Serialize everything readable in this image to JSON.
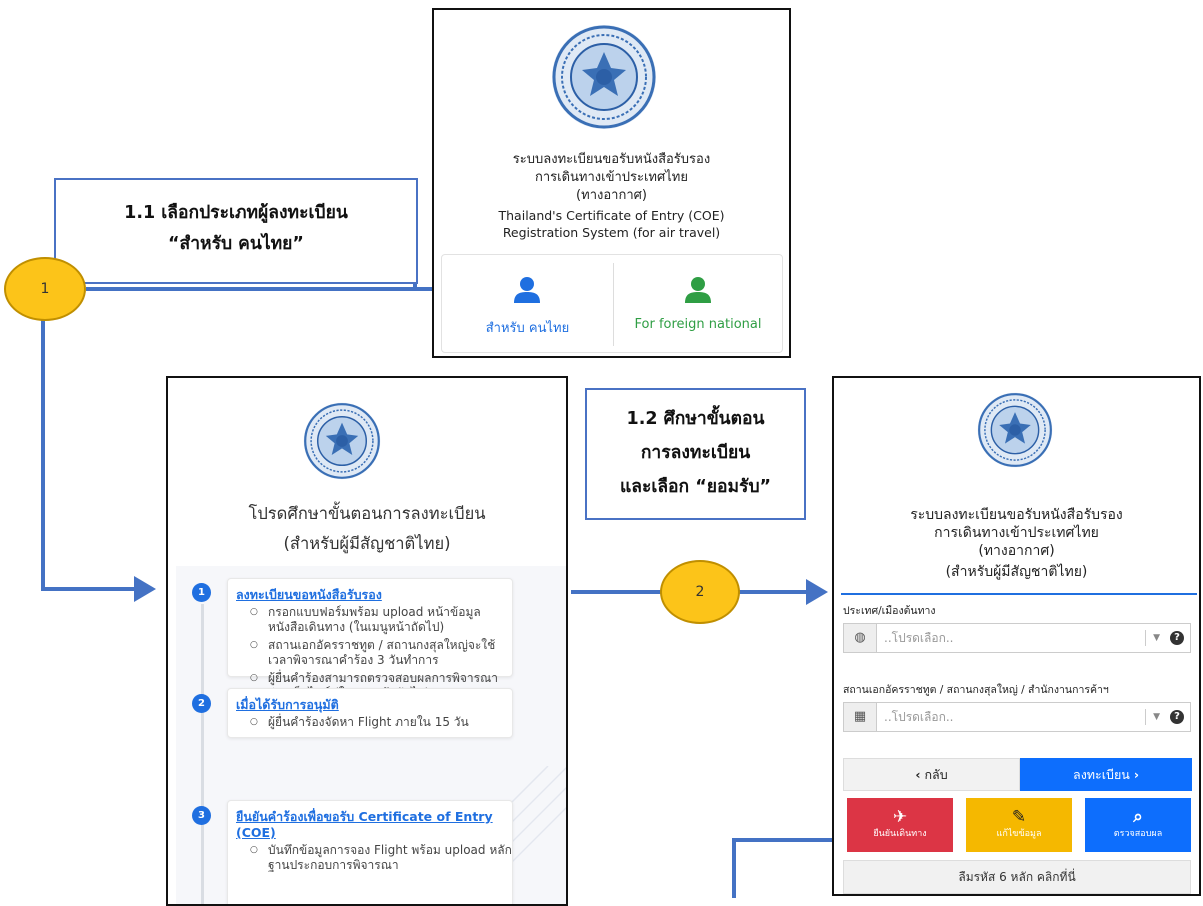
{
  "panel1": {
    "title_lines": [
      "ระบบลงทะเบียนขอรับหนังสือรับรอง",
      "การเดินทางเข้าประเทศไทย",
      "(ทางอากาศ)"
    ],
    "subtitle_lines": [
      "Thailand's Certificate of Entry (COE)",
      "Registration System (for air travel)"
    ],
    "choice_thai": "สำหรับ คนไทย",
    "choice_foreign": "For foreign national",
    "colors": {
      "thai": "#1f6fe0",
      "foreign": "#2f9e44"
    }
  },
  "annotation1": {
    "lines": [
      "1.1 เลือกประเภทผู้ลงทะเบียน",
      "“สำหรับ คนไทย”"
    ],
    "number": "1"
  },
  "annotation2": {
    "lines": [
      "1.2 ศึกษาขั้นตอน",
      "การลงทะเบียน",
      "และเลือก “ยอมรับ”"
    ],
    "number": "2"
  },
  "panel2": {
    "title_lines": [
      "โปรดศึกษาขั้นตอนการลงทะเบียน",
      "(สำหรับผู้มีสัญชาติไทย)"
    ],
    "steps": [
      {
        "number": "1",
        "title": "ลงทะเบียนขอหนังสือรับรอง",
        "items": [
          "กรอกแบบฟอร์มพร้อม upload หน้าข้อมูลหนังสือเดินทาง (ในเมนูหน้าถัดไป)",
          "สถานเอกอัครราชทูต / สถานกงสุลใหญ่จะใช้เวลาพิจารณาคำร้อง 3 วันทำการ",
          "ผู้ยื่นคำร้องสามารถตรวจสอบผลการพิจารณาผ่านเว็บไซต์ (ในเมนูหน้าถัดไป)"
        ]
      },
      {
        "number": "2",
        "title": "เมื่อได้รับการอนุมัติ",
        "items": [
          "ผู้ยื่นคำร้องจัดหา Flight ภายใน 15 วัน"
        ]
      },
      {
        "number": "3",
        "title": "ยืนยันคำร้องเพื่อขอรับ Certificate of Entry (COE)",
        "items": [
          "บันทึกข้อมูลการจอง Flight พร้อม upload หลักฐานประกอบการพิจารณา"
        ]
      }
    ]
  },
  "panel3": {
    "title_lines": [
      "ระบบลงทะเบียนขอรับหนังสือรับรอง",
      "การเดินทางเข้าประเทศไทย",
      "(ทางอากาศ)",
      "(สำหรับผู้มีสัญชาติไทย)"
    ],
    "origin_label": "ประเทศ/เมืองต้นทาง",
    "origin_placeholder": "..โปรดเลือก..",
    "embassy_label": "สถานเอกอัครราชทูต / สถานกงสุลใหญ่ / สำนักงานการค้าฯ",
    "embassy_placeholder": "..โปรดเลือก..",
    "back_label": "กลับ",
    "register_label": "ลงทะเบียน",
    "tiles": [
      {
        "label": "ยืนยันเดินทาง",
        "icon": "plane-departure-icon",
        "color": "#dc3545"
      },
      {
        "label": "แก้ไขข้อมูล",
        "icon": "user-edit-icon",
        "color": "#f5b800"
      },
      {
        "label": "ตรวจสอบผล",
        "icon": "search-icon",
        "color": "#0d6efd"
      }
    ],
    "forgot_label": "ลืมรหัส 6 หลัก คลิกที่นี่"
  }
}
